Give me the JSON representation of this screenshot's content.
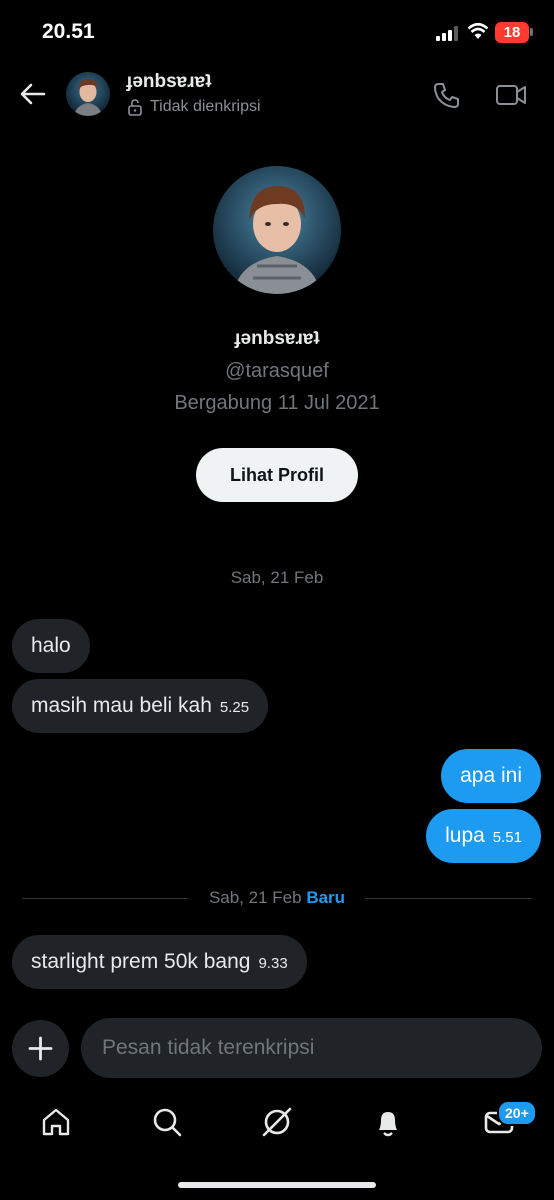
{
  "status_bar": {
    "time": "20.51",
    "battery": "18"
  },
  "header": {
    "name": "ɟǝnbsɐɹɐʇ",
    "subtitle": "Tidak dienkripsi"
  },
  "profile": {
    "name": "ɟǝnbsɐɹɐʇ",
    "handle": "@tarasquef",
    "joined": "Bergabung 11 Jul 2021",
    "view_button": "Lihat Profil"
  },
  "conversation": {
    "date_1": "Sab, 21 Feb",
    "messages": [
      {
        "text": "halo",
        "time": "",
        "from": "them"
      },
      {
        "text": "masih mau beli kah",
        "time": "5.25",
        "from": "them"
      },
      {
        "text": "apa ini",
        "time": "",
        "from": "me"
      },
      {
        "text": "lupa",
        "time": "5.51",
        "from": "me"
      }
    ],
    "date_2": "Sab, 21 Feb",
    "new_label": "Baru",
    "messages_new": [
      {
        "text": "starlight prem 50k bang",
        "time": "9.33",
        "from": "them"
      }
    ]
  },
  "composer": {
    "placeholder": "Pesan tidak terenkripsi"
  },
  "tabbar": {
    "items": [
      "home-icon",
      "search-icon",
      "grok-icon",
      "notifications-icon",
      "messages-icon"
    ],
    "messages_badge": "20+"
  },
  "colors": {
    "accent": "#1d9bf0",
    "incoming_bubble": "#202327",
    "background": "#000000"
  }
}
